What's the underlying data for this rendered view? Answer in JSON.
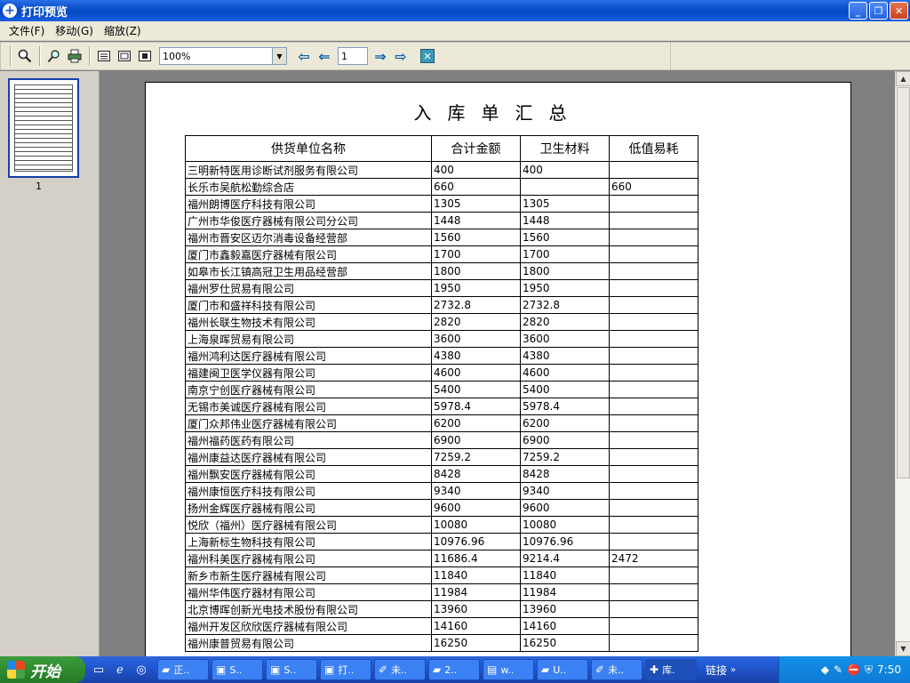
{
  "window": {
    "title": "打印预览",
    "minimize": "_",
    "restore": "❐",
    "close": "✕"
  },
  "menu": [
    {
      "label": "文件(F)"
    },
    {
      "label": "移动(G)"
    },
    {
      "label": "缩放(Z)"
    }
  ],
  "toolbar": {
    "zoom_value": "100%",
    "page_value": "1"
  },
  "thumbnail": {
    "page_label": "1"
  },
  "document": {
    "title": "入库单汇总",
    "headers": [
      "供货单位名称",
      "合计金额",
      "卫生材料",
      "低值易耗"
    ],
    "rows": [
      [
        "三明新特医用诊断试剂服务有限公司",
        "400",
        "400",
        ""
      ],
      [
        "长乐市吴航松勤综合店",
        "660",
        "",
        "660"
      ],
      [
        "福州朗博医疗科技有限公司",
        "1305",
        "1305",
        ""
      ],
      [
        "广州市华俊医疗器械有限公司分公司",
        "1448",
        "1448",
        ""
      ],
      [
        "福州市晋安区迈尔消毒设备经营部",
        "1560",
        "1560",
        ""
      ],
      [
        "厦门市鑫毅嘉医疗器械有限公司",
        "1700",
        "1700",
        ""
      ],
      [
        "如皋市长江镇高冠卫生用品经营部",
        "1800",
        "1800",
        ""
      ],
      [
        "福州罗仕贸易有限公司",
        "1950",
        "1950",
        ""
      ],
      [
        "厦门市和盛祥科技有限公司",
        "2732.8",
        "2732.8",
        ""
      ],
      [
        "福州长联生物技术有限公司",
        "2820",
        "2820",
        ""
      ],
      [
        "上海泉晖贸易有限公司",
        "3600",
        "3600",
        ""
      ],
      [
        "福州鸿利达医疗器械有限公司",
        "4380",
        "4380",
        ""
      ],
      [
        "福建闽卫医学仪器有限公司",
        "4600",
        "4600",
        ""
      ],
      [
        "南京宁创医疗器械有限公司",
        "5400",
        "5400",
        ""
      ],
      [
        "无锡市美诚医疗器械有限公司",
        "5978.4",
        "5978.4",
        ""
      ],
      [
        "厦门众邦伟业医疗器械有限公司",
        "6200",
        "6200",
        ""
      ],
      [
        "福州福药医药有限公司",
        "6900",
        "6900",
        ""
      ],
      [
        "福州康益达医疗器械有限公司",
        "7259.2",
        "7259.2",
        ""
      ],
      [
        "福州飘安医疗器械有限公司",
        "8428",
        "8428",
        ""
      ],
      [
        "福州康恒医疗科技有限公司",
        "9340",
        "9340",
        ""
      ],
      [
        "扬州金辉医疗器械有限公司",
        "9600",
        "9600",
        ""
      ],
      [
        "悦欣（福州）医疗器械有限公司",
        "10080",
        "10080",
        ""
      ],
      [
        "上海新标生物科技有限公司",
        "10976.96",
        "10976.96",
        ""
      ],
      [
        "福州科美医疗器械有限公司",
        "11686.4",
        "9214.4",
        "2472"
      ],
      [
        "新乡市新生医疗器械有限公司",
        "11840",
        "11840",
        ""
      ],
      [
        "福州华伟医疗器材有限公司",
        "11984",
        "11984",
        ""
      ],
      [
        "北京博晖创新光电技术股份有限公司",
        "13960",
        "13960",
        ""
      ],
      [
        "福州开发区欣欣医疗器械有限公司",
        "14160",
        "14160",
        ""
      ],
      [
        "福州康普贸易有限公司",
        "16250",
        "16250",
        ""
      ]
    ]
  },
  "taskbar": {
    "start_label": "开始",
    "tasks": [
      {
        "label": "正..",
        "icon": "folder-icon",
        "active": false
      },
      {
        "label": "S..",
        "icon": "app-icon",
        "active": false
      },
      {
        "label": "S..",
        "icon": "app-icon",
        "active": false
      },
      {
        "label": "打..",
        "icon": "app-icon",
        "active": false
      },
      {
        "label": "未..",
        "icon": "paint-icon",
        "active": false
      },
      {
        "label": "2..",
        "icon": "folder-icon",
        "active": false
      },
      {
        "label": "w..",
        "icon": "document-icon",
        "active": false
      },
      {
        "label": "U..",
        "icon": "folder-icon",
        "active": false
      },
      {
        "label": "未..",
        "icon": "paint-icon",
        "active": false
      },
      {
        "label": "库.",
        "icon": "app-icon",
        "active": true
      }
    ],
    "links_label": "链接",
    "clock": "7:50"
  }
}
